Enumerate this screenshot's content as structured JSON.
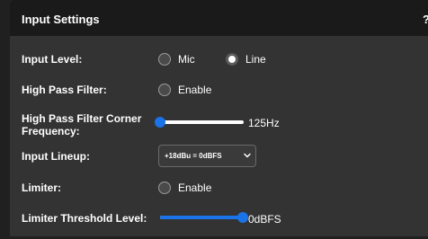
{
  "header": {
    "title": "Input Settings",
    "help_label": "?"
  },
  "rows": {
    "input_level": {
      "label": "Input Level:",
      "options": [
        "Mic",
        "Line"
      ],
      "selected": "Line"
    },
    "high_pass_filter": {
      "label": "High Pass Filter:",
      "toggle_label": "Enable",
      "checked": false
    },
    "hpf_corner_frequency": {
      "label": "High Pass Filter Corner Frequency:",
      "value_text": "125Hz",
      "level": 0.0
    },
    "input_lineup": {
      "label": "Input Lineup:",
      "selected_value": "+18dBu = 0dBFS"
    },
    "limiter": {
      "label": "Limiter:",
      "toggle_label": "Enable",
      "checked": false
    },
    "limiter_threshold": {
      "label": "Limiter Threshold Level:",
      "value_text": "0dBFS",
      "level": 1.0
    }
  },
  "colors": {
    "accent": "#1a73e8",
    "panel_bg": "#333333",
    "header_bg": "#1a1a1a",
    "page_bg": "#202020"
  },
  "icons": {
    "help": "help-icon",
    "dropdown": "chevron-down-icon"
  }
}
